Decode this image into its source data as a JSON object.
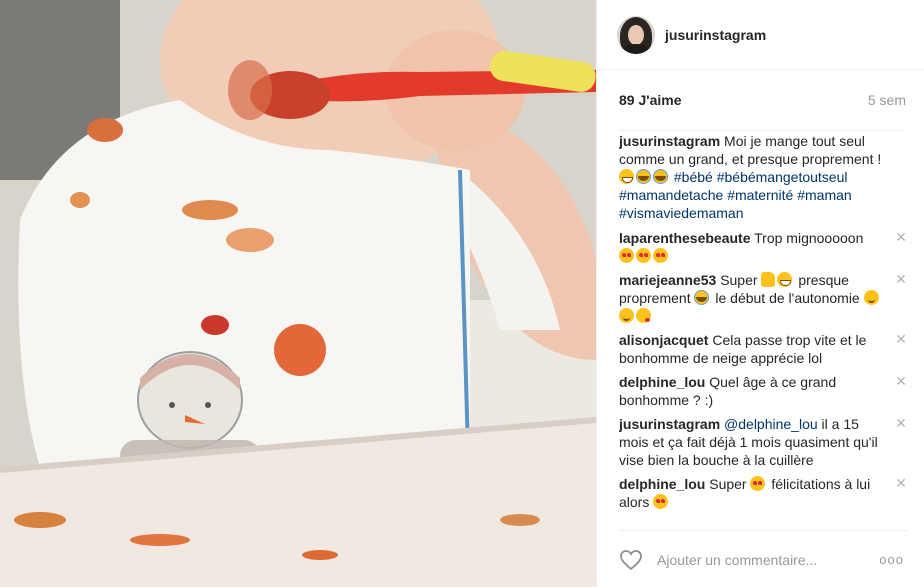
{
  "post": {
    "username": "jusurinstagram",
    "likes": "89 J'aime",
    "age": "5 sem"
  },
  "caption": {
    "user": "jusurinstagram",
    "text": "Moi je mange tout seul comme un grand, et presque proprement !",
    "hashtags": [
      "#bébé",
      "#bébémangetoutseul",
      "#mamandetache",
      "#maternité",
      "#maman",
      "#vismaviedemaman"
    ]
  },
  "comments": [
    {
      "user": "laparenthesebeaute",
      "text": "Trop mignooooon"
    },
    {
      "user": "mariejeanne53",
      "text_a": "Super",
      "text_b": "presque proprement",
      "text_c": "le début de l'autonomie"
    },
    {
      "user": "alisonjacquet",
      "text": "Cela passe trop vite et le bonhomme de neige apprécie lol"
    },
    {
      "user": "delphine_lou",
      "text": "Quel âge à ce grand bonhomme ? :)"
    },
    {
      "user": "jusurinstagram",
      "mention": "@delphine_lou",
      "text": "il a 15 mois et ça fait déjà 1 mois quasiment qu'il vise bien la bouche à la cuillère"
    },
    {
      "user": "delphine_lou",
      "text_a": "Super",
      "text_b": "félicitations à lui alors"
    }
  ],
  "footer": {
    "placeholder": "Ajouter un commentaire...",
    "more": "ooo"
  },
  "colors": {
    "hashtag": "#003569",
    "text": "#262626",
    "muted": "#999999"
  },
  "icons": [
    "heart-icon",
    "close-icon",
    "more-options-icon"
  ]
}
